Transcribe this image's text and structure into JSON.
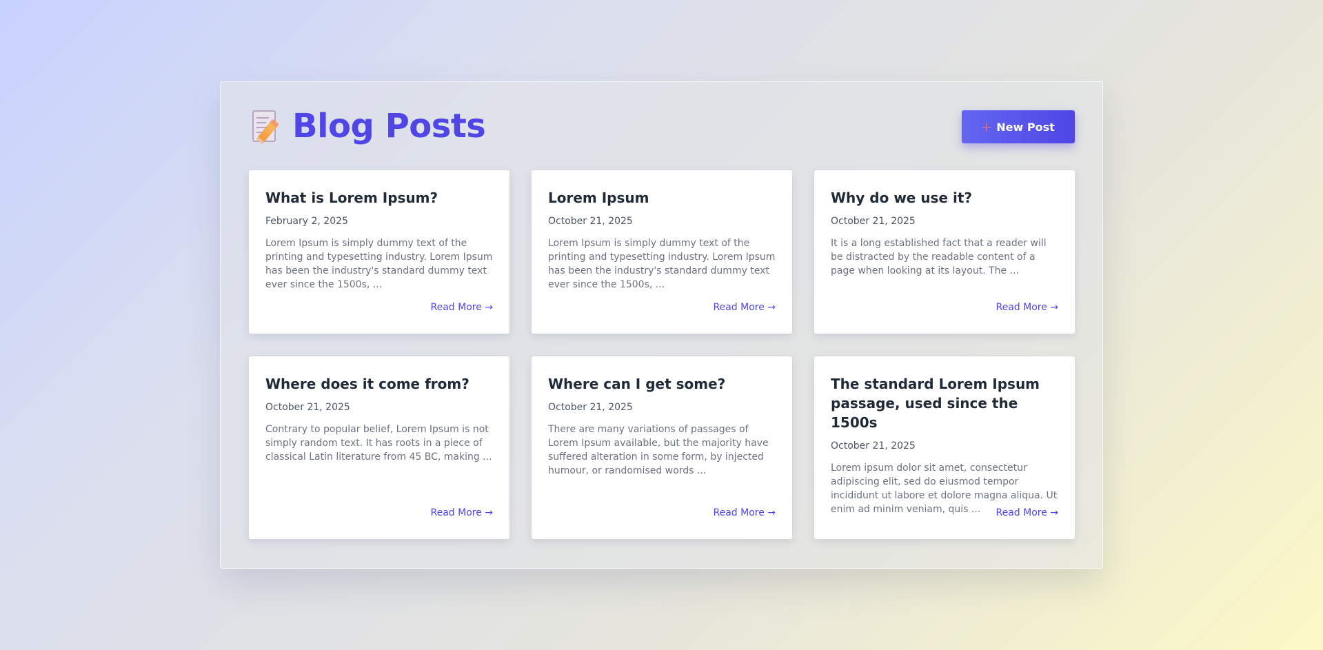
{
  "header": {
    "icon": "memo-pencil-icon",
    "title": "Blog Posts",
    "new_post_label": "New Post",
    "new_post_icon": "plus-icon"
  },
  "colors": {
    "accent": "#4f46e5",
    "title_text": "#1f2937",
    "excerpt_text": "#6b7280"
  },
  "posts": [
    {
      "title": "What is Lorem Ipsum?",
      "date": "February 2, 2025",
      "excerpt": "Lorem Ipsum is simply dummy text of the printing and typesetting industry. Lorem Ipsum has been the industry's standard dummy text ever since the 1500s, ...",
      "link": "Read More →"
    },
    {
      "title": "Lorem Ipsum",
      "date": "October 21, 2025",
      "excerpt": "Lorem Ipsum is simply dummy text of the printing and typesetting industry. Lorem Ipsum has been the industry's standard dummy text ever since the 1500s, ...",
      "link": "Read More →"
    },
    {
      "title": "Why do we use it?",
      "date": "October 21, 2025",
      "excerpt": "It is a long established fact that a reader will be distracted by the readable content of a page when looking at its layout. The ...",
      "link": "Read More →"
    },
    {
      "title": "Where does it come from?",
      "date": "October 21, 2025",
      "excerpt": "Contrary to popular belief, Lorem Ipsum is not simply random text. It has roots in a piece of classical Latin literature from 45 BC, making ...",
      "link": "Read More →"
    },
    {
      "title": "Where can I get some?",
      "date": "October 21, 2025",
      "excerpt": "There are many variations of passages of Lorem Ipsum available, but the majority have suffered alteration in some form, by injected humour, or randomised words ...",
      "link": "Read More →"
    },
    {
      "title": "The standard Lorem Ipsum passage, used since the 1500s",
      "date": "October 21, 2025",
      "excerpt": "Lorem ipsum dolor sit amet, consectetur adipiscing elit, sed do eiusmod tempor incididunt ut labore et dolore magna aliqua. Ut enim ad minim veniam, quis ...",
      "link": "Read More →"
    }
  ]
}
